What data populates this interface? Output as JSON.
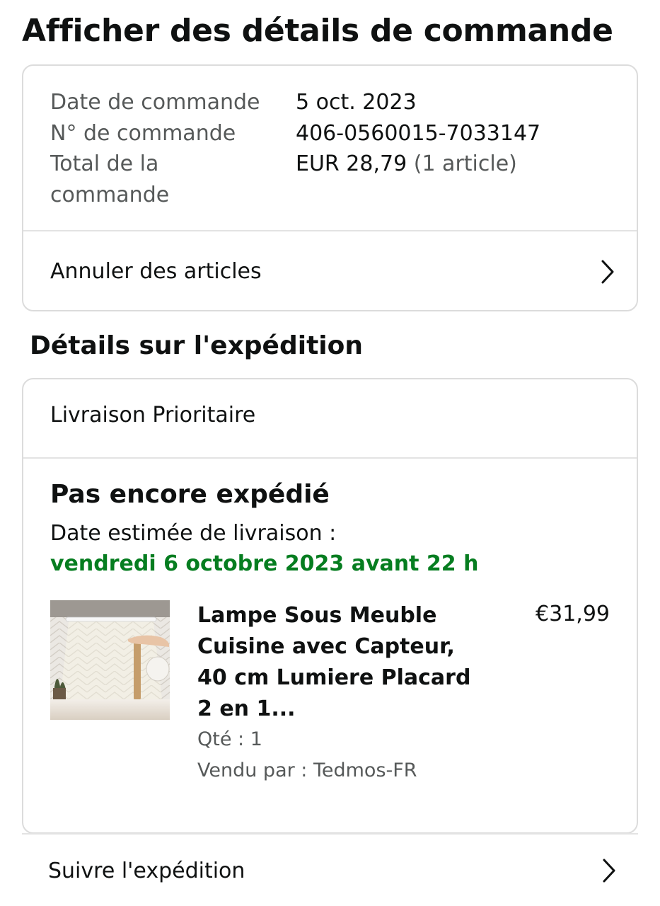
{
  "page": {
    "title": "Afficher des détails de commande"
  },
  "summary": {
    "rows": [
      {
        "label": "Date de commande",
        "value": "5 oct. 2023"
      },
      {
        "label": "N° de commande",
        "value": "406-0560015-7033147"
      }
    ],
    "total_label_line1": "Total de la",
    "total_label_line2": "commande",
    "total_value": "EUR 28,79",
    "total_items": "(1 article)",
    "cancel_link": "Annuler des articles"
  },
  "shipment": {
    "section_title": "Détails sur l'expédition",
    "method": "Livraison Prioritaire",
    "status": "Pas encore expédié",
    "eta_label": "Date estimée de livraison :",
    "eta_date": "vendredi 6 octobre 2023 avant 22 h",
    "eta_color": "#067d20",
    "item": {
      "title": "Lampe Sous Meuble Cuisine avec Capteur, 40 cm Lumiere Placard 2 en 1...",
      "price": "€31,99",
      "quantity": "Qté : 1",
      "seller": "Vendu par : Tedmos-FR",
      "image_alt": "under-cabinet-light-product-image"
    },
    "track_link": "Suivre l'expédition"
  },
  "icons": {
    "chevron": "chevron-right-icon"
  }
}
